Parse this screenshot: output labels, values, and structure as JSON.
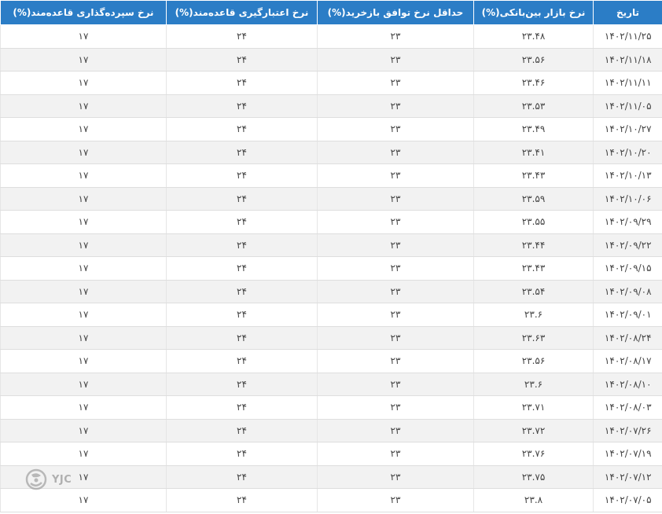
{
  "table": {
    "headers": [
      "تاریخ",
      "نرخ بازار بین‌بانکی(%)",
      "حداقل نرخ توافق بازخرید(%)",
      "نرخ اعتبارگیری قاعده‌مند(%)",
      "نرخ سپرده‌گذاری قاعده‌مند(%)"
    ],
    "rows": [
      [
        "۱۴۰۲/۱۱/۲۵",
        "۲۳.۴۸",
        "۲۳",
        "۲۴",
        "۱۷"
      ],
      [
        "۱۴۰۲/۱۱/۱۸",
        "۲۳.۵۶",
        "۲۳",
        "۲۴",
        "۱۷"
      ],
      [
        "۱۴۰۲/۱۱/۱۱",
        "۲۳.۴۶",
        "۲۳",
        "۲۴",
        "۱۷"
      ],
      [
        "۱۴۰۲/۱۱/۰۵",
        "۲۳.۵۳",
        "۲۳",
        "۲۴",
        "۱۷"
      ],
      [
        "۱۴۰۲/۱۰/۲۷",
        "۲۳.۴۹",
        "۲۳",
        "۲۴",
        "۱۷"
      ],
      [
        "۱۴۰۲/۱۰/۲۰",
        "۲۳.۴۱",
        "۲۳",
        "۲۴",
        "۱۷"
      ],
      [
        "۱۴۰۲/۱۰/۱۳",
        "۲۳.۴۳",
        "۲۳",
        "۲۴",
        "۱۷"
      ],
      [
        "۱۴۰۲/۱۰/۰۶",
        "۲۳.۵۹",
        "۲۳",
        "۲۴",
        "۱۷"
      ],
      [
        "۱۴۰۲/۰۹/۲۹",
        "۲۳.۵۵",
        "۲۳",
        "۲۴",
        "۱۷"
      ],
      [
        "۱۴۰۲/۰۹/۲۲",
        "۲۳.۴۴",
        "۲۳",
        "۲۴",
        "۱۷"
      ],
      [
        "۱۴۰۲/۰۹/۱۵",
        "۲۳.۴۳",
        "۲۳",
        "۲۴",
        "۱۷"
      ],
      [
        "۱۴۰۲/۰۹/۰۸",
        "۲۳.۵۴",
        "۲۳",
        "۲۴",
        "۱۷"
      ],
      [
        "۱۴۰۲/۰۹/۰۱",
        "۲۳.۶",
        "۲۳",
        "۲۴",
        "۱۷"
      ],
      [
        "۱۴۰۲/۰۸/۲۴",
        "۲۳.۶۳",
        "۲۳",
        "۲۴",
        "۱۷"
      ],
      [
        "۱۴۰۲/۰۸/۱۷",
        "۲۳.۵۶",
        "۲۳",
        "۲۴",
        "۱۷"
      ],
      [
        "۱۴۰۲/۰۸/۱۰",
        "۲۳.۶",
        "۲۳",
        "۲۴",
        "۱۷"
      ],
      [
        "۱۴۰۲/۰۸/۰۳",
        "۲۳.۷۱",
        "۲۳",
        "۲۴",
        "۱۷"
      ],
      [
        "۱۴۰۲/۰۷/۲۶",
        "۲۳.۷۲",
        "۲۳",
        "۲۴",
        "۱۷"
      ],
      [
        "۱۴۰۲/۰۷/۱۹",
        "۲۳.۷۶",
        "۲۳",
        "۲۴",
        "۱۷"
      ],
      [
        "۱۴۰۲/۰۷/۱۲",
        "۲۳.۷۵",
        "۲۳",
        "۲۴",
        "۱۷"
      ],
      [
        "۱۴۰۲/۰۷/۰۵",
        "۲۳.۸",
        "۲۳",
        "۲۴",
        "۱۷"
      ]
    ]
  },
  "watermark": {
    "text": "YJC"
  },
  "colors": {
    "header_bg": "#2b7dc6",
    "header_text": "#ffffff",
    "row_alt": "#f2f2f2"
  }
}
